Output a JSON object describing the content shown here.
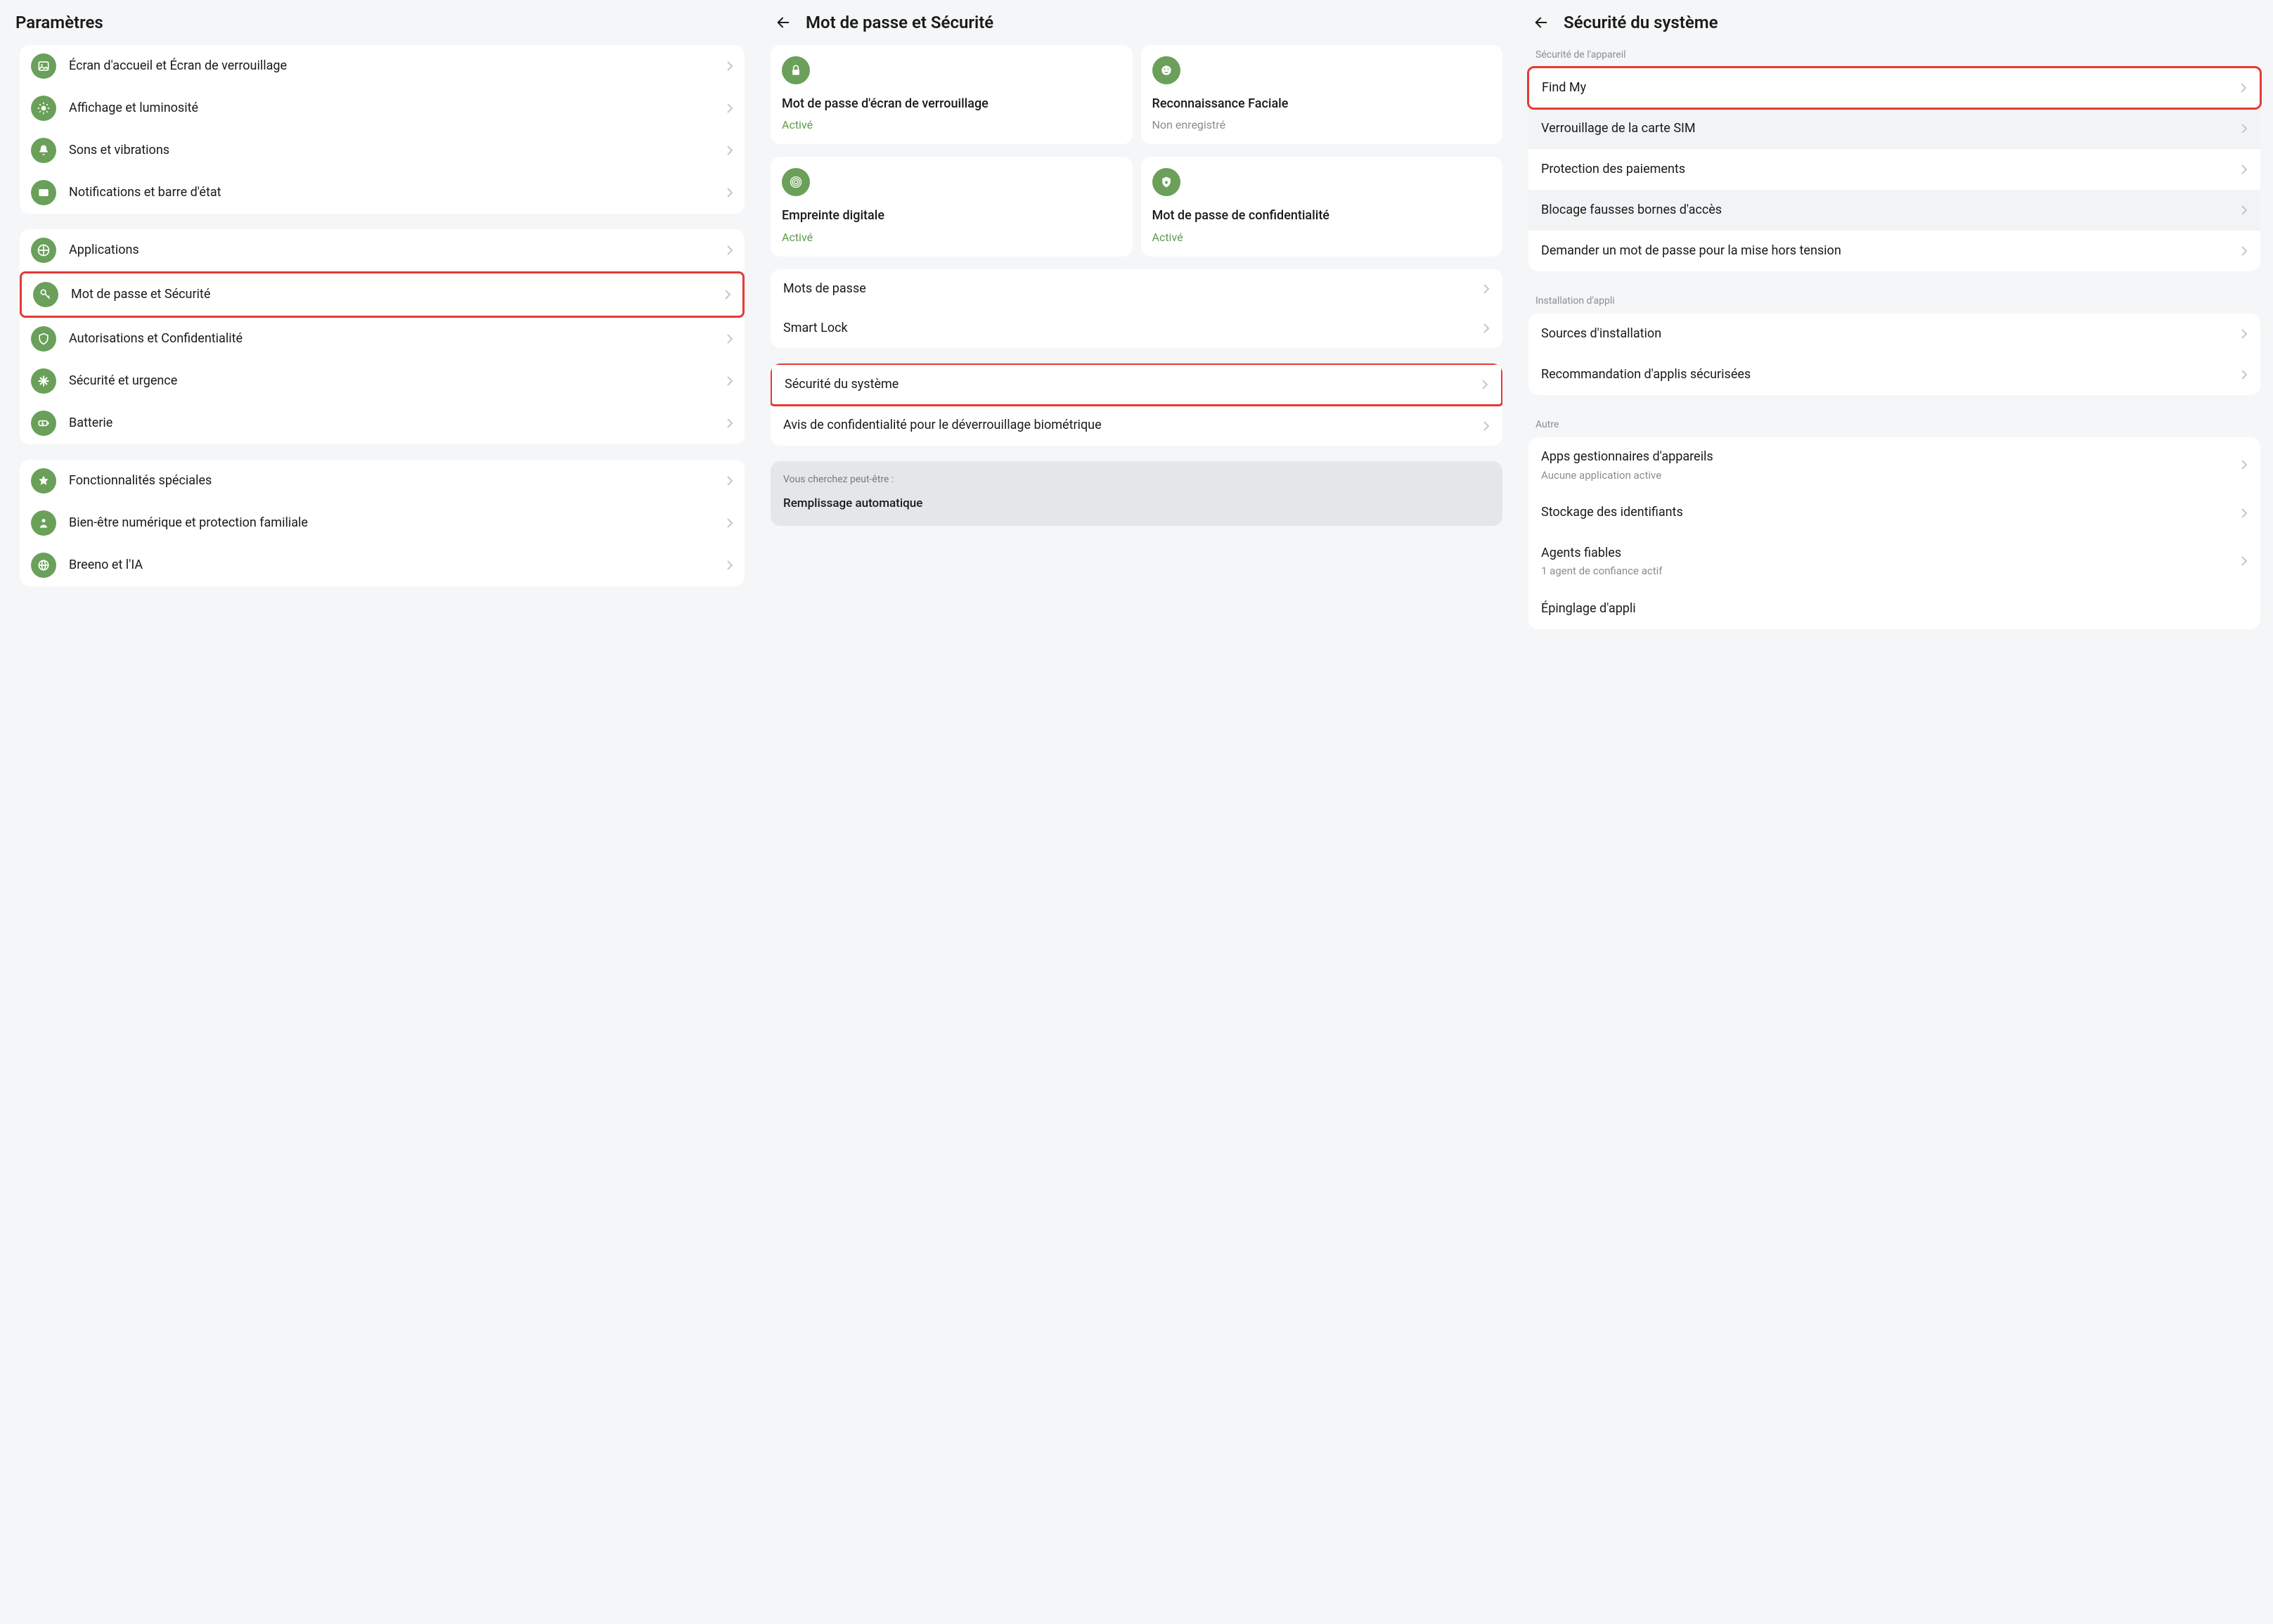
{
  "colors": {
    "accent_green": "#6aa05a",
    "status_active": "#5e9a4c",
    "highlight_red": "#e53935"
  },
  "panel1": {
    "title": "Paramètres",
    "group1": [
      {
        "icon": "image-icon",
        "label": "Écran d'accueil et Écran de verrouillage"
      },
      {
        "icon": "brightness-icon",
        "label": "Affichage et luminosité"
      },
      {
        "icon": "bell-icon",
        "label": "Sons et vibrations"
      },
      {
        "icon": "notification-icon",
        "label": "Notifications et barre d'état"
      }
    ],
    "group2": [
      {
        "icon": "grid-icon",
        "label": "Applications"
      },
      {
        "icon": "key-icon",
        "label": "Mot de passe et Sécurité",
        "highlighted": true
      },
      {
        "icon": "shield-icon",
        "label": "Autorisations et Confidentialité"
      },
      {
        "icon": "medical-icon",
        "label": "Sécurité et urgence"
      },
      {
        "icon": "battery-icon",
        "label": "Batterie"
      }
    ],
    "group3": [
      {
        "icon": "star-icon",
        "label": "Fonctionnalités spéciales"
      },
      {
        "icon": "wellbeing-icon",
        "label": "Bien-être numérique et protection familiale"
      },
      {
        "icon": "globe-icon",
        "label": "Breeno et l'IA"
      }
    ]
  },
  "panel2": {
    "title": "Mot de passe et Sécurité",
    "cards1": [
      {
        "icon": "lock-icon",
        "title": "Mot de passe d'écran de verrouillage",
        "status": "Activé",
        "status_kind": "active"
      },
      {
        "icon": "face-icon",
        "title": "Reconnaissance Faciale",
        "status": "Non enregistré",
        "status_kind": "inactive"
      }
    ],
    "cards2": [
      {
        "icon": "fingerprint-icon",
        "title": "Empreinte digitale",
        "status": "Activé",
        "status_kind": "active"
      },
      {
        "icon": "privacy-lock-icon",
        "title": "Mot de passe de confidentialité",
        "status": "Activé",
        "status_kind": "active"
      }
    ],
    "list1": [
      {
        "label": "Mots de passe"
      },
      {
        "label": "Smart Lock"
      }
    ],
    "list2": [
      {
        "label": "Sécurité du système",
        "highlighted": true
      },
      {
        "label": "Avis de confidentialité pour le déverrouillage biométrique"
      }
    ],
    "suggest_head": "Vous cherchez peut-être :",
    "suggest_item": "Remplissage automatique"
  },
  "panel3": {
    "title": "Sécurité du système",
    "sec1_head": "Sécurité de l'appareil",
    "sec1": [
      {
        "label": "Find My",
        "highlighted": true
      },
      {
        "label": "Verrouillage de la carte SIM",
        "alt": true
      },
      {
        "label": "Protection des paiements"
      },
      {
        "label": "Blocage fausses bornes d'accès",
        "alt": true
      },
      {
        "label": "Demander un mot de passe pour la mise hors tension"
      }
    ],
    "sec2_head": "Installation d'appli",
    "sec2": [
      {
        "label": "Sources d'installation"
      },
      {
        "label": "Recommandation d'applis sécurisées"
      }
    ],
    "sec3_head": "Autre",
    "sec3": [
      {
        "label": "Apps gestionnaires d'appareils",
        "sub": "Aucune application active"
      },
      {
        "label": "Stockage des identifiants"
      },
      {
        "label": "Agents fiables",
        "sub": "1 agent de confiance actif"
      },
      {
        "label": "Épinglage d'appli"
      }
    ]
  }
}
